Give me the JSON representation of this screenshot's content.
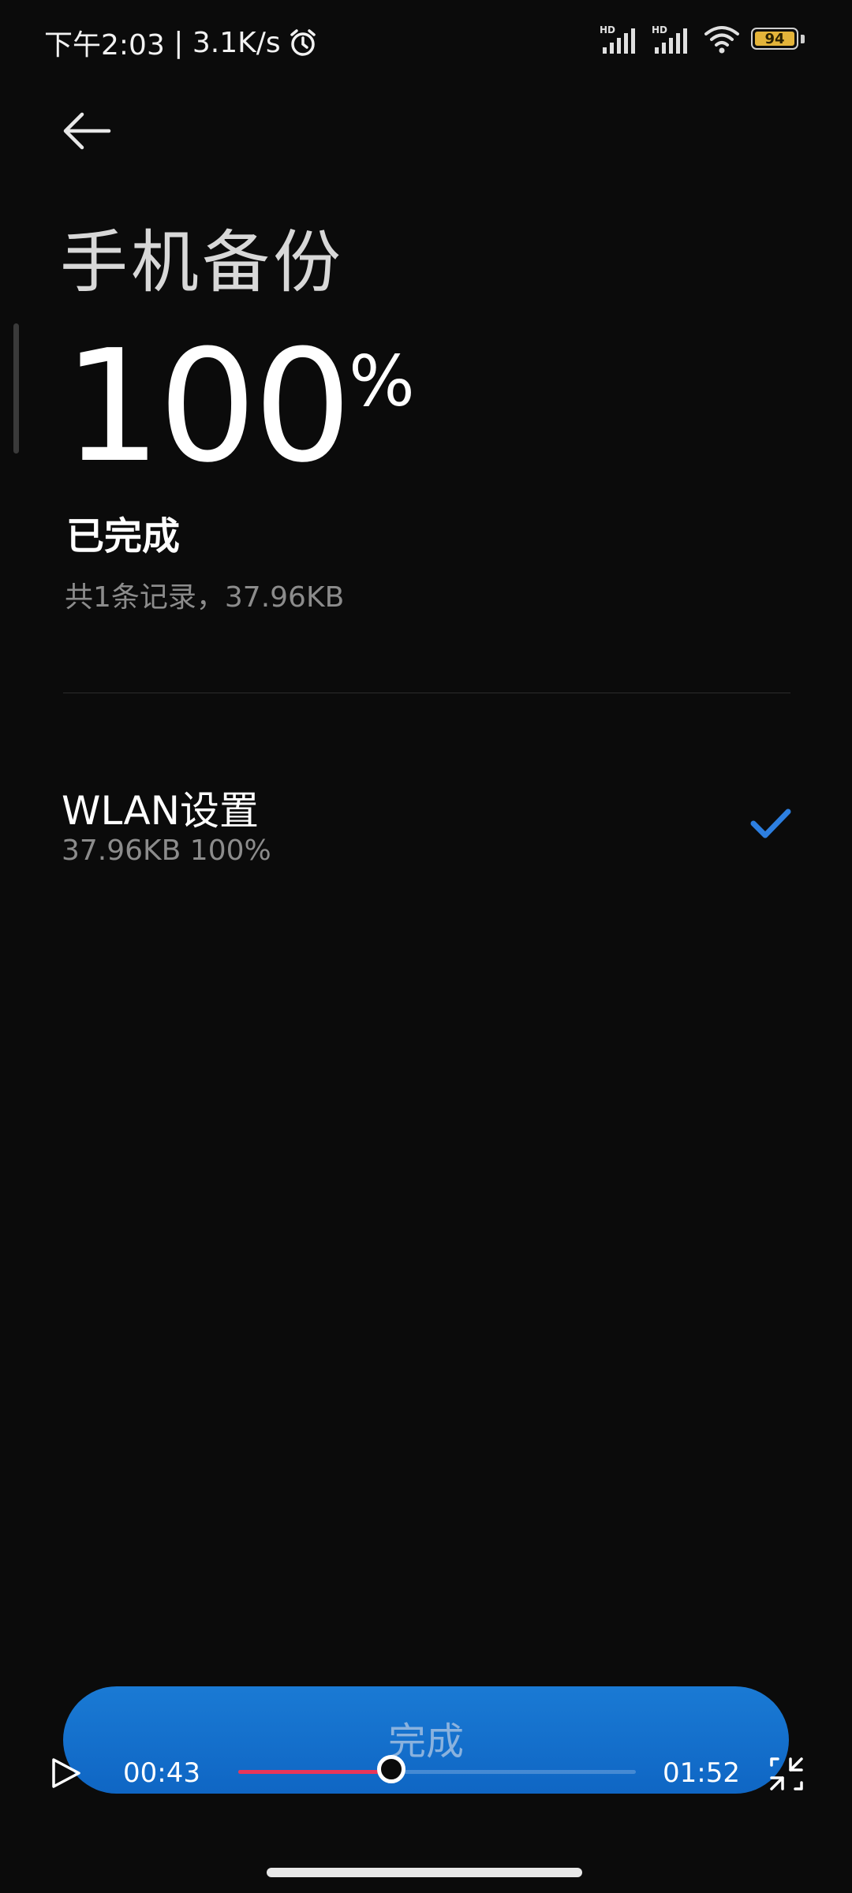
{
  "status_bar": {
    "time": "下午2:03",
    "network_speed": "3.1K/s",
    "sim1_label": "HD",
    "sim2_label": "HD",
    "battery": "94",
    "icons": [
      "alarm-icon",
      "signal-icon",
      "signal-icon",
      "wifi-icon",
      "battery-icon"
    ]
  },
  "header": {
    "back_icon": "arrow-left-icon",
    "title": "手机备份"
  },
  "progress": {
    "percent_value": "100",
    "percent_sign": "%",
    "status": "已完成",
    "summary": "共1条记录，37.96KB"
  },
  "items": [
    {
      "name": "WLAN设置",
      "detail": "37.96KB 100%",
      "icon": "check-icon",
      "accent_color": "#2d7fe0"
    }
  ],
  "done_button": {
    "label": "完成",
    "color": "#1673cf"
  },
  "video_player": {
    "play_icon": "play-icon",
    "current_time": "00:43",
    "total_time": "01:52",
    "progress_fraction": 0.384,
    "progress_color": "#e8365a",
    "fullscreen_icon": "exit-fullscreen-icon"
  }
}
